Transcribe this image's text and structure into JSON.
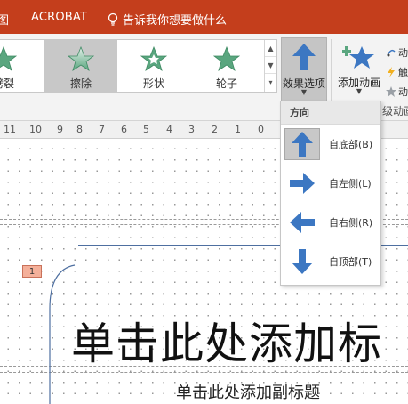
{
  "tabbar": {
    "partial_tab": "图",
    "acrobat": "ACROBAT",
    "tell_me": "告诉我你想要做什么",
    "icon": "lightbulb-icon"
  },
  "ribbon": {
    "effects": [
      {
        "label": "劈裂",
        "icon": "star-icon",
        "selected": false
      },
      {
        "label": "擦除",
        "icon": "star-icon",
        "selected": true
      },
      {
        "label": "形状",
        "icon": "star-icon",
        "selected": false
      },
      {
        "label": "轮子",
        "icon": "star-icon",
        "selected": false
      }
    ],
    "effect_options": {
      "label": "效果选项",
      "icon": "arrow-up-icon"
    },
    "add_animation": {
      "label": "添加动画",
      "icon": "star-plus-icon"
    },
    "small_tools": [
      "动",
      "触",
      "动"
    ],
    "group_label": "级动画"
  },
  "ruler": {
    "labels": [
      "11",
      "10",
      "9",
      "8",
      "7",
      "6",
      "5",
      "4",
      "3",
      "2",
      "1",
      "0"
    ]
  },
  "slide": {
    "animation_badge": "1",
    "title_placeholder": "单击此处添加标",
    "subtitle_placeholder": "单击此处添加副标题"
  },
  "direction_menu": {
    "header": "方向",
    "items": [
      {
        "label": "自底部(B)",
        "icon": "arrow-up-icon",
        "selected": true
      },
      {
        "label": "自左侧(L)",
        "icon": "arrow-right-icon",
        "selected": false
      },
      {
        "label": "自右侧(R)",
        "icon": "arrow-left-icon",
        "selected": false
      },
      {
        "label": "自顶部(T)",
        "icon": "arrow-down-icon",
        "selected": false
      }
    ]
  },
  "colors": {
    "tab_bar": "#c43e1c",
    "star_green": "#5aa67f",
    "arrow_blue": "#3c77c2"
  }
}
